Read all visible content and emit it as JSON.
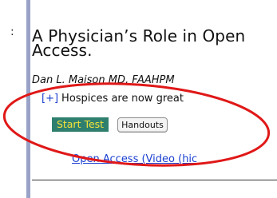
{
  "course": {
    "title": "A Physician’s Role in Open Access.",
    "author": "Dan L. Maison MD, FAAHPM",
    "expand_toggle": "[+]",
    "description_preview": "Hospices are now great"
  },
  "actions": {
    "start_label": "Start Test",
    "handouts_label": "Handouts"
  },
  "links": {
    "video_label": "Open Access (Video (hic"
  },
  "markers": {
    "tick": ":"
  },
  "colors": {
    "sidebar": "#9aa3c7",
    "start_bg": "#2f7f6e",
    "start_text": "#f4e23a",
    "link": "#1a3fd1",
    "annotation_ring": "#e01818"
  }
}
